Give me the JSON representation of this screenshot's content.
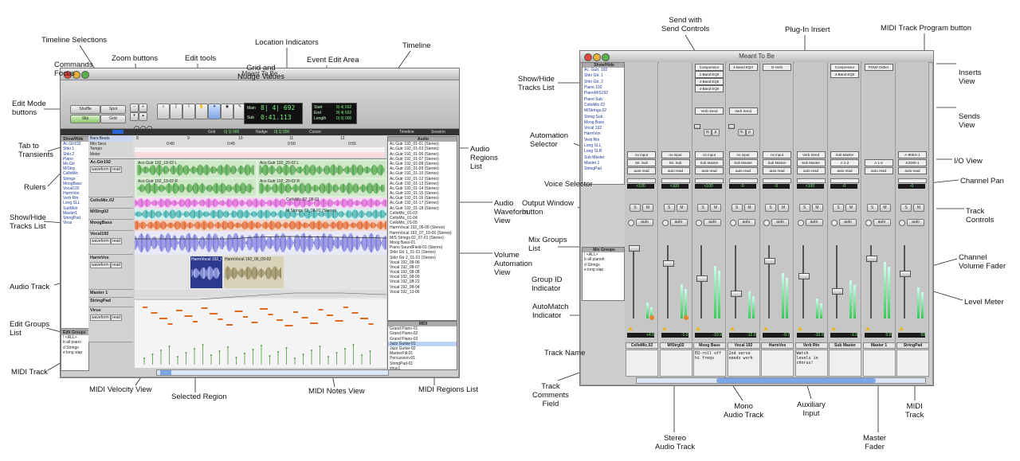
{
  "left_window": {
    "title": "Meant To Be",
    "mode_buttons": [
      "Shuffle",
      "Spot",
      "Slip",
      "Grid"
    ],
    "counter": {
      "main_label": "Main",
      "main_value": "8| 4| 692",
      "sub_label": "Sub",
      "sub_value": "0:41.113",
      "start_label": "Start",
      "start_value": "8| 4| 692",
      "end_label": "End",
      "end_value": "8| 4| 692",
      "length_label": "Length",
      "length_value": "0| 0| 000"
    },
    "grid_label": "Grid",
    "grid_value": "0| 1| 000",
    "nudge_label": "Nudge",
    "nudge_value": "0| 1| 000",
    "cursor_label": "Cursor",
    "timeline_label": "Timeline",
    "session_label": "Session",
    "rulers": [
      "Bars:Beats",
      "Min:Secs",
      "Tempo",
      "Meter"
    ],
    "ruler_ticks": [
      "0:40",
      "0:45",
      "0:50",
      "0:55"
    ],
    "bar_numbers": [
      "8",
      "9",
      "10",
      "11",
      "12"
    ],
    "show_hide_header": "Show/Hide",
    "tracks_list": [
      "Ac.Gtr192",
      "Shkr.1",
      "Shkr.2",
      "Piano",
      "Ms.Gtr",
      "M/Strg",
      "CelloMic",
      "Strings",
      "MoogBass",
      "Vocal192",
      "HarmVox",
      "Verb Rtn",
      "Long SLL",
      "SubMstr",
      "Master1",
      "StringPad",
      "Virus"
    ],
    "tracks": [
      {
        "name": "Ac.Gtr192"
      },
      {
        "name": "CelloMic.02"
      },
      {
        "name": "M/Strg02"
      },
      {
        "name": "MoogBass"
      },
      {
        "name": "Vocal192"
      },
      {
        "name": "HarmVox"
      },
      {
        "name": "Master 1"
      },
      {
        "name": "StringPad"
      },
      {
        "name": "Virus"
      }
    ],
    "edit_groups_header": "Edit Groups",
    "edit_groups": [
      "! <ALL>",
      "b all piano",
      "d Strings",
      "e long slap"
    ],
    "audio_regions_header": "Audio",
    "audio_regions": [
      "Ac.Gutr 192_01-01 (Stereo)",
      "Ac.Gutr 192_01-03 (Stereo)",
      "Ac.Gutr 192_01-06 (Stereo)",
      "Ac.Gutr 192_01-07 (Stereo)",
      "Ac.Gutr 192_01-08 (Stereo)",
      "Ac.Gutr 192_01-09 (Stereo)",
      "Ac.Gutr 192_01-10 (Stereo)",
      "Ac.Gutr 192_01-12 (Stereo)",
      "Ac.Gutr 192_01-13 (Stereo)",
      "Ac.Gutr 192_01-14 (Stereo)",
      "Ac.Gutr 192_01-15 (Stereo)",
      "Ac.Gutr 192_01-16 (Stereo)",
      "Ac.Gutr 192_01-17 (Stereo)",
      "Ac.Gutr 192_01-18 (Stereo)",
      "CelloMic_01-03",
      "CelloMic_01-04",
      "CelloMic_01-05",
      "HarmVocal 192_06-06 (Stereo)",
      "HarmVocal 192_07_10-06 (Stereo)",
      "M/S Strings 02_07-01 (Stereo)",
      "Moog Bass-01",
      "Piano SoundField-01 (Stereo)",
      "Shkr Gtr 1_01-01 (Stereo)",
      "Shkr Gtr 2_01-01 (Stereo)",
      "Vocal 192_08-06",
      "Vocal 192_08-07",
      "Vocal 192_08-08",
      "Vocal 192_08-09",
      "Vocal 192_08-22",
      "Vocal 192_08-04",
      "Vocal 192_13-06"
    ],
    "midi_regions_header": "MIDI",
    "midi_regions": [
      "Grand Piano-01",
      "Grand Piano-02",
      "Grand Piano-03",
      "Jazz Guitar-01",
      "Jazz Guitar-02",
      "MarkerFill-01",
      "Percussion-01",
      "StringPad-01",
      "virus1",
      "virus2",
      "virus3",
      "virus4"
    ],
    "audio_clip_labels": [
      "Aco Gutr 192_19-02 L",
      "Aco Gutr 192_19-02 R",
      "Aco Gutr 192_20-02 L",
      "Aco Gutr 192_20-02 R"
    ],
    "cello_clip_label": "CelloMic 02_08-01",
    "strings_clip_label": "M Strings 02_08-01 (Stereo)",
    "selected_region_label": "HarmVocal 192_07_10",
    "harm_clip_label": "HarmVocal 192_06_09-02",
    "track_controls": [
      "waveform",
      "read",
      "volume",
      "velocity",
      "notes",
      "auto"
    ]
  },
  "right_window": {
    "title": "Meant To Be",
    "show_hide_header": "Show/Hide",
    "tracks_list": [
      "Ac. Gutr. 192",
      "Shkr Gtr. 1",
      "Shkr Gtr. 2",
      "Piano 192",
      "PianoM/S192",
      "Piano Sub",
      "CelloMic.02",
      "M/Strings.02",
      "String Sub",
      "Moog Bass",
      "Vocal 192",
      "HarmVox",
      "Verb Rtn",
      "Long SLL",
      "Long SLR",
      "Sub Master",
      "Master 1",
      "StringPad"
    ],
    "mix_groups_header": "Mix Groups",
    "mix_groups": [
      "! <ALL>",
      "b all pianoh",
      "d Strings",
      "e long slap"
    ],
    "strips": [
      {
        "name": "CelloMic.02",
        "inserts": [],
        "send": "",
        "input": "no input",
        "output": "Str. Sub",
        "auto": "auto read",
        "pan": "<100",
        "vol": "+4.5",
        "comment": ""
      },
      {
        "name": "M/Strg02",
        "inserts": [],
        "send": "",
        "input": "no input",
        "output": "Str. Sub",
        "auto": "auto read",
        "pan": "<100",
        "vol": "-1.0",
        "comment": ""
      },
      {
        "name": "Moog Bass",
        "inserts": [
          "Compressor",
          "1-Band EQII",
          "4-Band EQII",
          "4-Band EQII"
        ],
        "send": "Verb Send",
        "input": "no input",
        "output": "Sub Master",
        "auto": "auto read",
        "pan": "<100",
        "vol": "-10.9",
        "comment": "EQ-roll off\nhi freqs"
      },
      {
        "name": "Vocal 192",
        "inserts": [
          "4-Band EQII"
        ],
        "send": "Verb Send",
        "input": "no input",
        "output": "Sub Master",
        "auto": "auto read",
        "pan": "-0",
        "vol": "-12.0",
        "comment": "2nd verse\nneeds work"
      },
      {
        "name": "HarmVox",
        "inserts": [
          "D-Verb"
        ],
        "send": "",
        "input": "no input",
        "output": "Sub Master",
        "auto": "auto read",
        "pan": "-0",
        "vol": "-9.7",
        "comment": ""
      },
      {
        "name": "Verb Rtn",
        "inserts": [],
        "send": "",
        "input": "Verb Send",
        "output": "Sub Master",
        "auto": "auto read",
        "pan": "<100",
        "vol": "-10.0",
        "comment": "Watch\nlevels in\nchorus!"
      },
      {
        "name": "Sub Master",
        "inserts": [
          "Compressor",
          "4-Band EQII"
        ],
        "send": "",
        "input": "Sub Master",
        "output": "A 1-2",
        "auto": "auto read",
        "pan": "-0",
        "vol": "-1.0",
        "comment": ""
      },
      {
        "name": "Master 1",
        "inserts": [
          "POWr Dither"
        ],
        "send": "",
        "input": "",
        "output": "A 1-2",
        "auto": "auto read",
        "pan": "",
        "vol": "0.0",
        "comment": ""
      },
      {
        "name": "StringPad",
        "inserts": [],
        "send": "",
        "input": "A-90EX-1",
        "output": "K2000-1",
        "auto": "auto read",
        "pan": "-0",
        "vol": "59",
        "comment": ""
      }
    ],
    "send_pan_labels": [
      "m",
      "p"
    ],
    "solo_label": "S",
    "mute_label": "M",
    "auto_label": "auto"
  },
  "callouts_left": {
    "edit_mode_buttons": "Edit Mode\nbuttons",
    "timeline_selections": "Timeline Selections",
    "commands_focus": "Commands\nFocus",
    "zoom_buttons": "Zoom buttons",
    "edit_tools": "Edit tools",
    "location_indicators": "Location Indicators",
    "grid_nudge": "Grid and\nNudge Values",
    "event_edit_area": "Event Edit Area",
    "timeline": "Timeline",
    "tab_to_transients": "Tab to\nTransients",
    "rulers": "Rulers",
    "show_hide_tracks_list": "Show/Hide\nTracks List",
    "audio_track": "Audio Track",
    "edit_groups_list": "Edit Groups\nList",
    "midi_track": "MIDI Track",
    "midi_velocity_view": "MIDI Velocity View",
    "selected_region": "Selected Region",
    "midi_notes_view": "MIDI Notes View",
    "midi_regions_list": "MIDI Regions List",
    "audio_regions_list": "Audio\nRegions\nList",
    "audio_waveform_view": "Audio\nWaveform\nView",
    "volume_automation_view": "Volume\nAutomation\nView"
  },
  "callouts_right": {
    "send_controls": "Send with\nSend Controls",
    "plugin_insert": "Plug-In Insert",
    "midi_program_button": "MIDI Track Program button",
    "show_hide_tracks_list": "Show/Hide\nTracks List",
    "inserts_view": "Inserts\nView",
    "sends_view": "Sends\nView",
    "automation_selector": "Automation\nSelector",
    "io_view": "I/O View",
    "voice_selector": "Voice Selector",
    "channel_pan": "Channel Pan",
    "output_window_button": "Output Window\nbutton",
    "track_controls": "Track\nControls",
    "mix_groups_list": "Mix Groups\nList",
    "channel_volume_fader": "Channel\nVolume Fader",
    "group_id_indicator": "Group ID\nIndicator",
    "level_meter": "Level Meter",
    "automatch_indicator": "AutoMatch\nIndicator",
    "track_name": "Track Name",
    "track_comments_field": "Track\nComments\nField",
    "mono_audio_track": "Mono\nAudio Track",
    "auxiliary_input": "Auxiliary\nInput",
    "midi_track": "MIDI\nTrack",
    "stereo_audio_track": "Stereo\nAudio Track",
    "master_fader": "Master\nFader"
  },
  "colors": {
    "waveform_green": "#3f9a3a",
    "waveform_magenta": "#d64fd0",
    "waveform_teal": "#2aa3a0",
    "waveform_orange": "#e05a1e",
    "waveform_violet": "#6b6bd8",
    "selection_blue": "#2b3a8c",
    "midi_orange": "#e06a20",
    "midi_green": "#4c9a3c",
    "scroll_blue": "#7aa7e8"
  }
}
